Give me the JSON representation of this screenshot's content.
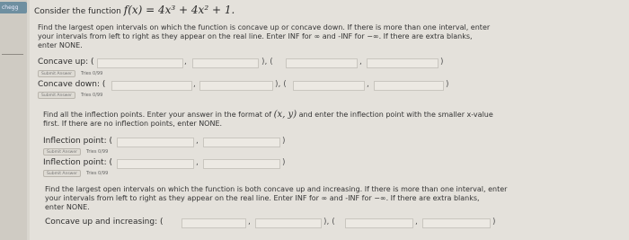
{
  "header": {
    "logo": "chegg"
  },
  "question": {
    "prefix": "Consider the function",
    "function": "f(x) = 4x³ + 4x² + 1."
  },
  "part1": {
    "instructions_lines": [
      "Find the largest open intervals on which the function is concave up or concave down. If there is more than one interval, enter",
      "your intervals from left to right as they appear on the real line. Enter INF for ∞ and -INF for −∞. If there are extra blanks,",
      "enter NONE."
    ],
    "concave_up_label": "Concave up: (",
    "concave_down_label": "Concave down: (",
    "submit_label": "Submit Answer",
    "tries": "Tries 0/99"
  },
  "part2": {
    "instr_a": "Find all the inflection points. Enter your answer in the format of",
    "instr_xy": "(x, y)",
    "instr_b": "and enter the inflection point with the smaller x-value",
    "instr_line2": "first. If there are no inflection points, enter NONE.",
    "point_label": "Inflection point: (",
    "submit_label": "Submit Answer",
    "tries": "Tries 0/99"
  },
  "part3": {
    "instructions_lines": [
      "Find the largest open intervals on which the function is both concave up and increasing. If there is more than one interval, enter",
      "your intervals from left to right as they appear on the real line. Enter INF for ∞ and -INF for −∞. If there are extra blanks,",
      "enter NONE."
    ],
    "label": "Concave up and increasing: ("
  },
  "punct": {
    "comma": ",",
    "close_open": "), (",
    "close": ")"
  }
}
